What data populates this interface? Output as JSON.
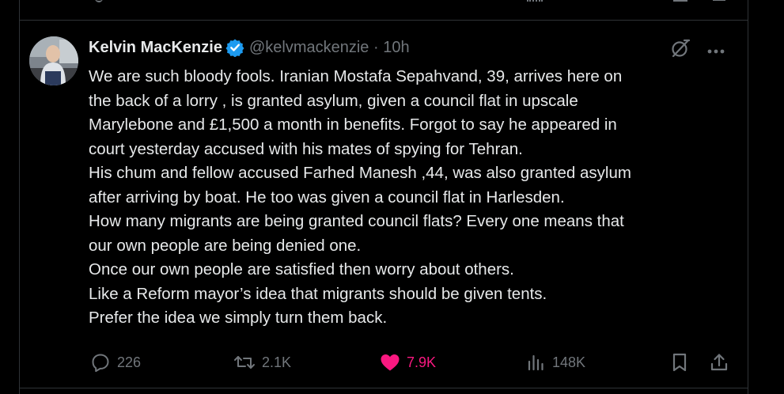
{
  "tweet": {
    "author": {
      "display_name": "Kelvin MacKenzie",
      "handle_meta": "@kelvmackenzie · 10h",
      "verified_color": "#1d9bf0"
    },
    "body_lines": [
      "We are such bloody fools. Iranian Mostafa Sepahvand, 39, arrives here on",
      "the back of a lorry , is granted asylum, given a council flat in upscale",
      "Marylebone and £1,500 a month in benefits. Forgot to say he appeared in",
      "court yesterday accused with his mates of spying for Tehran.",
      "His chum and fellow accused Farhed Manesh ,44, was also granted asylum",
      "after arriving by boat. He too was given a council flat in Harlesden.",
      "How many migrants are being granted council flats? Every one means that",
      "our own people are being denied one.",
      "Once our own people are satisfied then worry about others.",
      "Like a Reform mayor’s idea that migrants should be given tents.",
      "Prefer the idea we simply turn them back."
    ],
    "header_icons": [
      "grok-icon",
      "more-icon"
    ],
    "actions": {
      "replies": "226",
      "reposts": "2.1K",
      "likes": "7.9K",
      "views": "148K"
    },
    "colors": {
      "text": "#e7e9ea",
      "muted": "#71767b",
      "like": "#f91880",
      "border": "#2f3336",
      "background": "#000000"
    }
  }
}
